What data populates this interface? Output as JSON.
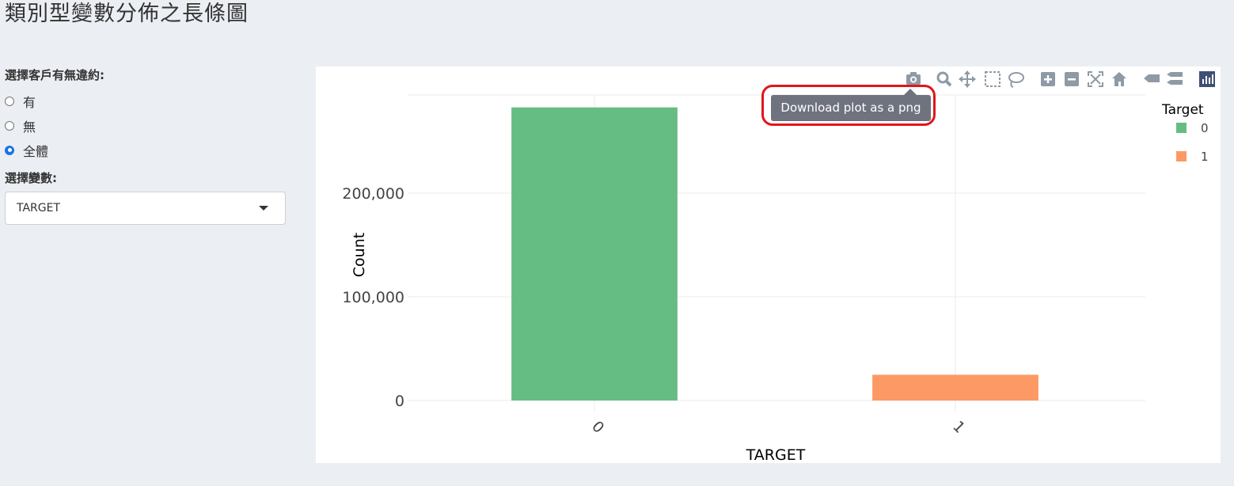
{
  "page": {
    "title": "類別型變數分佈之長條圖"
  },
  "sidebar": {
    "radio_label": "選擇客戶有無違約:",
    "radio_options": [
      {
        "label": "有",
        "checked": false
      },
      {
        "label": "無",
        "checked": false
      },
      {
        "label": "全體",
        "checked": true
      }
    ],
    "select_label": "選擇變數:",
    "select_value": "TARGET"
  },
  "modebar": {
    "tooltip": "Download plot as a png",
    "icons": [
      "camera-icon",
      "zoom-icon",
      "pan-icon",
      "box-select-icon",
      "lasso-select-icon",
      "zoom-in-icon",
      "zoom-out-icon",
      "autoscale-icon",
      "reset-axes-icon",
      "hover-closest-icon",
      "hover-compare-icon",
      "plotly-logo-icon"
    ]
  },
  "chart_data": {
    "type": "bar",
    "categories": [
      "0",
      "1"
    ],
    "series": [
      {
        "name": "0",
        "color": "#66bd84",
        "values": [
          282686,
          null
        ]
      },
      {
        "name": "1",
        "color": "#fc9965",
        "values": [
          null,
          24825
        ]
      }
    ],
    "xlabel": "TARGET",
    "ylabel": "Count",
    "ylim": [
      0,
      300000
    ],
    "yticks": [
      0,
      100000,
      200000
    ],
    "ytick_labels": [
      "0",
      "100,000",
      "200,000"
    ],
    "legend_title": "Target",
    "legend_position": "top-right",
    "grid": true
  }
}
